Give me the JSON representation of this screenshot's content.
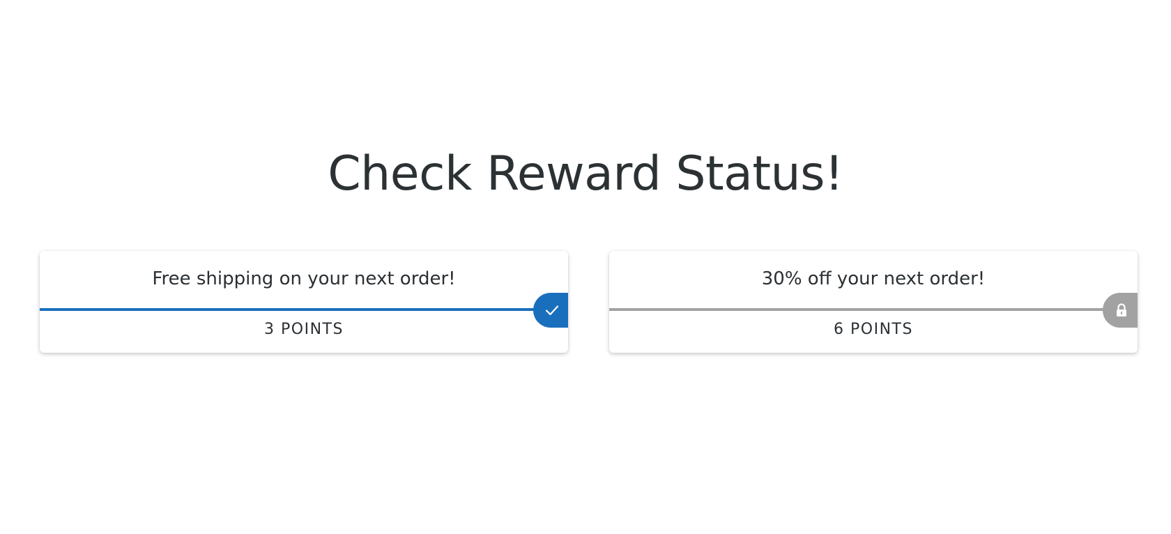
{
  "page": {
    "title": "Check Reward Status!"
  },
  "rewards": [
    {
      "title": "Free shipping on your next order!",
      "points": "3 POINTS",
      "status": "unlocked",
      "status_icon": "check-icon",
      "color": "#1a6fbd"
    },
    {
      "title": "30% off your next order!",
      "points": "6 POINTS",
      "status": "locked",
      "status_icon": "lock-icon",
      "color": "#a2a2a2"
    }
  ]
}
